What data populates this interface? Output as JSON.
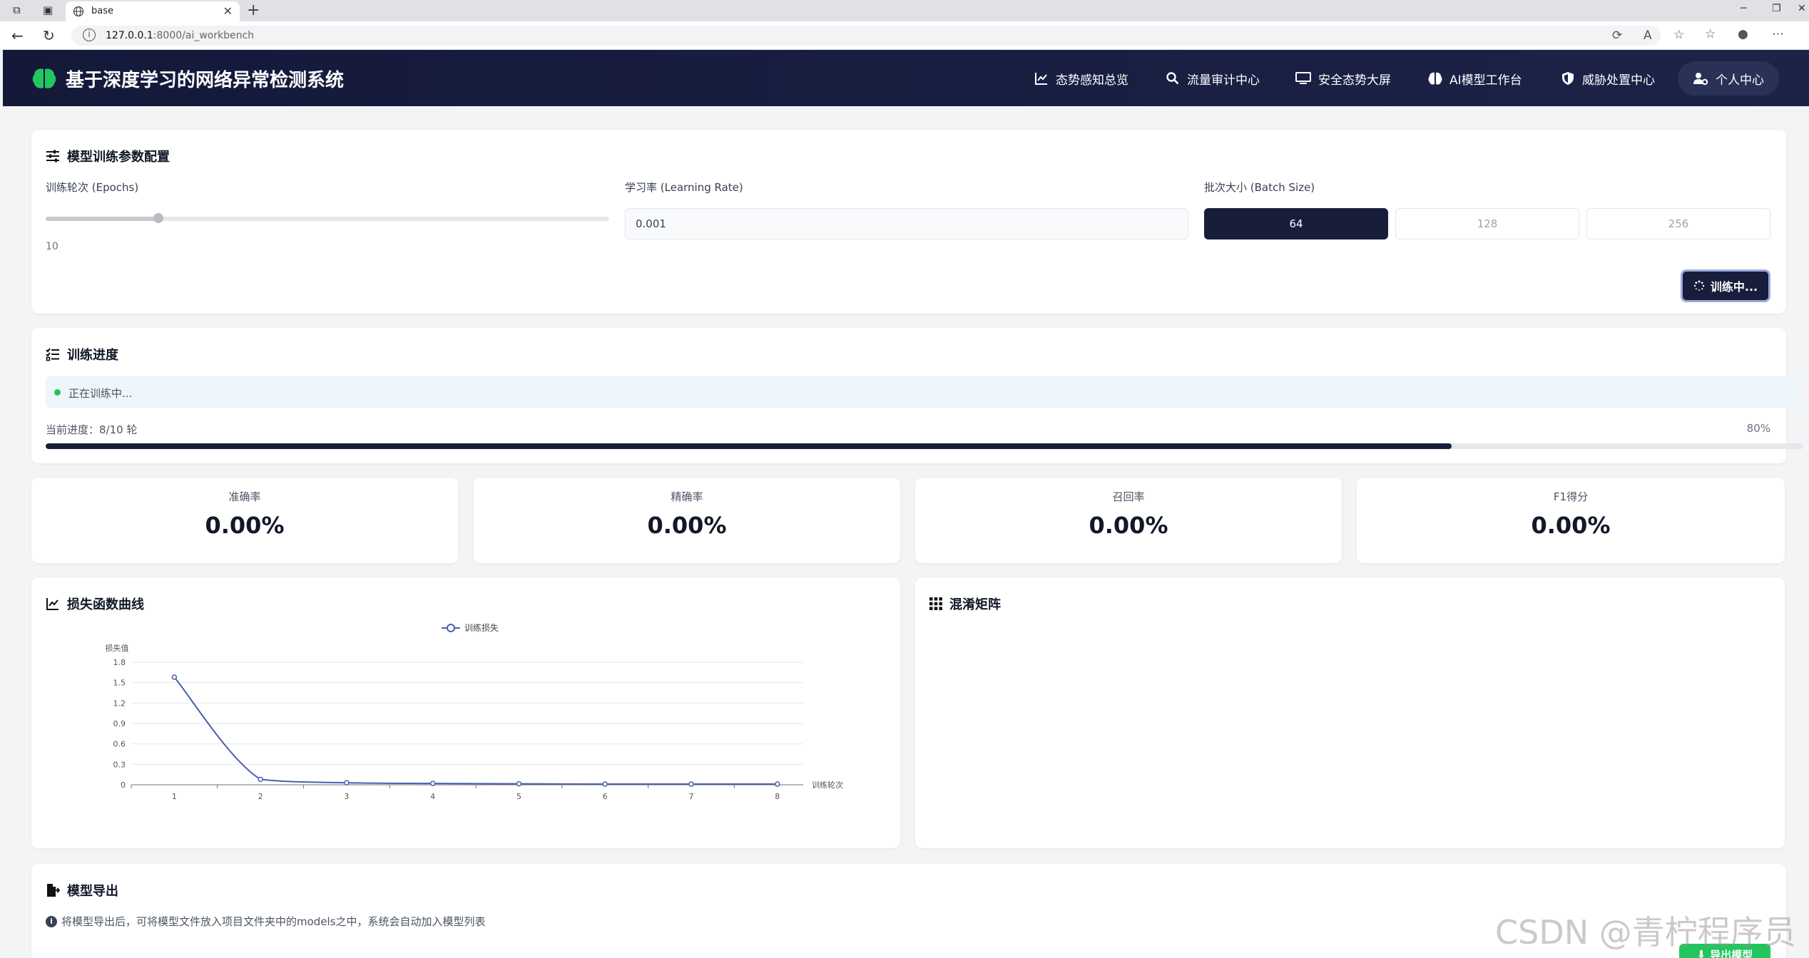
{
  "browser": {
    "tab_title": "base",
    "url_host": "127.0.0.1",
    "url_rest": ":8000/ai_workbench"
  },
  "app": {
    "title": "基于深度学习的网络异常检测系统",
    "nav": [
      {
        "label": "态势感知总览",
        "icon": "line-chart-icon"
      },
      {
        "label": "流量审计中心",
        "icon": "search-icon"
      },
      {
        "label": "安全态势大屏",
        "icon": "monitor-icon"
      },
      {
        "label": "AI模型工作台",
        "icon": "brain-icon"
      },
      {
        "label": "威胁处置中心",
        "icon": "shield-icon"
      },
      {
        "label": "个人中心",
        "icon": "user-cog-icon"
      }
    ]
  },
  "config": {
    "title": "模型训练参数配置",
    "epochs_label": "训练轮次 (Epochs)",
    "epochs_value": "10",
    "epochs_slider_fraction": 0.2,
    "lr_label": "学习率 (Learning Rate)",
    "lr_value": "0.001",
    "batch_label": "批次大小 (Batch Size)",
    "batch_options": [
      "64",
      "128",
      "256"
    ],
    "batch_selected": "64",
    "train_button": "训练中..."
  },
  "progress": {
    "title": "训练进度",
    "status": "正在训练中...",
    "current_label": "当前进度：8/10 轮",
    "percent_text": "80%",
    "percent": 80
  },
  "metrics": [
    {
      "label": "准确率",
      "value": "0.00%"
    },
    {
      "label": "精确率",
      "value": "0.00%"
    },
    {
      "label": "召回率",
      "value": "0.00%"
    },
    {
      "label": "F1得分",
      "value": "0.00%"
    }
  ],
  "loss_chart": {
    "title": "损失函数曲线"
  },
  "confusion": {
    "title": "混淆矩阵"
  },
  "export": {
    "title": "模型导出",
    "note": "将模型导出后，可将模型文件放入项目文件夹中的models之中，系统会自动加入模型列表",
    "button": "导出模型"
  },
  "watermark": "CSDN @青柠程序员",
  "colors": {
    "header_bg": "#181d3b",
    "accent_dark": "#181d3b",
    "success": "#22c55e",
    "line": "#4a5fb0"
  },
  "chart_data": {
    "type": "line",
    "x": [
      1,
      2,
      3,
      4,
      5,
      6,
      7,
      8
    ],
    "series": [
      {
        "name": "训练损失",
        "values": [
          1.58,
          0.08,
          0.03,
          0.02,
          0.015,
          0.01,
          0.01,
          0.01
        ]
      }
    ],
    "title": "",
    "xlabel": "训练轮次",
    "ylabel": "损失值",
    "ylim": [
      0,
      1.8
    ],
    "yticks": [
      "0",
      "0.3",
      "0.6",
      "0.9",
      "1.2",
      "1.5",
      "1.8"
    ],
    "grid": true,
    "legend_position": "top-center"
  }
}
